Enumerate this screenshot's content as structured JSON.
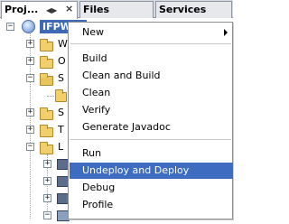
{
  "tabs": [
    {
      "label": "Proj..."
    },
    {
      "label": "Files"
    },
    {
      "label": "Services"
    }
  ],
  "tab_controls": {
    "left_right": "◀▶",
    "close": "×"
  },
  "tree": {
    "project_label": "IFPW...",
    "rows": [
      {
        "letter": "W"
      },
      {
        "letter": "O"
      },
      {
        "letter": "S"
      },
      {
        "letter": ""
      },
      {
        "letter": "S"
      },
      {
        "letter": "T"
      },
      {
        "letter": "L"
      }
    ]
  },
  "context_menu": {
    "items": [
      {
        "label": "New",
        "has_submenu": true
      },
      {
        "label": "Build"
      },
      {
        "label": "Clean and Build"
      },
      {
        "label": "Clean"
      },
      {
        "label": "Verify"
      },
      {
        "label": "Generate Javadoc"
      },
      {
        "label": "Run"
      },
      {
        "label": "Undeploy and Deploy",
        "highlighted": true
      },
      {
        "label": "Debug"
      },
      {
        "label": "Profile"
      }
    ]
  },
  "colors": {
    "selection": "#3d6cc0",
    "project_highlight": "#3d69b5",
    "folder": "#f2cf6a"
  }
}
